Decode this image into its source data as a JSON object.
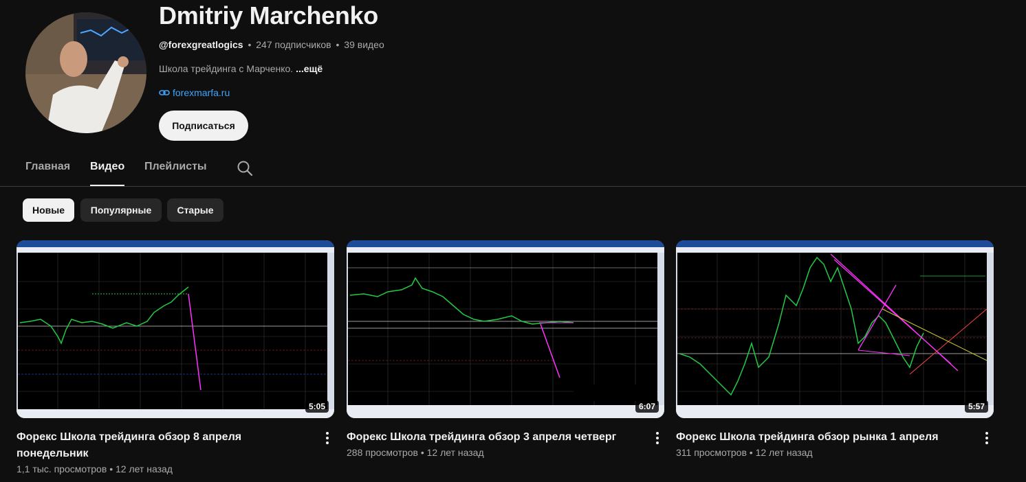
{
  "channel": {
    "name": "Dmitriy Marchenko",
    "handle": "@forexgreatlogics",
    "subscribers": "247 подписчиков",
    "videos_count": "39 видео",
    "separator": "•",
    "description": "Школа трейдинга с Марченко.",
    "more_label": "...ещё",
    "link": "forexmarfa.ru",
    "subscribe_label": "Подписаться"
  },
  "tabs": [
    {
      "label": "Главная"
    },
    {
      "label": "Видео"
    },
    {
      "label": "Плейлисты"
    }
  ],
  "chips": [
    {
      "label": "Новые"
    },
    {
      "label": "Популярные"
    },
    {
      "label": "Старые"
    }
  ],
  "videos": [
    {
      "title": "Форекс Школа трейдинга обзор 8 апреля понедельник",
      "views": "1,1 тыс. просмотров",
      "age": "12 лет назад",
      "duration": "5:05"
    },
    {
      "title": "Форекс Школа трейдинга обзор 3 апреля четверг",
      "views": "288 просмотров",
      "age": "12 лет назад",
      "duration": "6:07"
    },
    {
      "title": "Форекс Школа трейдинга  обзор рынка 1 апреля",
      "views": "311 просмотров",
      "age": "12 лет назад",
      "duration": "5:57"
    }
  ],
  "icons": {
    "avatar": "avatar-photo",
    "link": "link-icon",
    "search": "search-icon",
    "more": "more-vertical-icon"
  },
  "colors": {
    "background": "#0f0f0f",
    "link": "#3ea6ff",
    "chip": "#272727",
    "chart_line": "#22cc44",
    "chart_trend": "#ff33ff"
  }
}
